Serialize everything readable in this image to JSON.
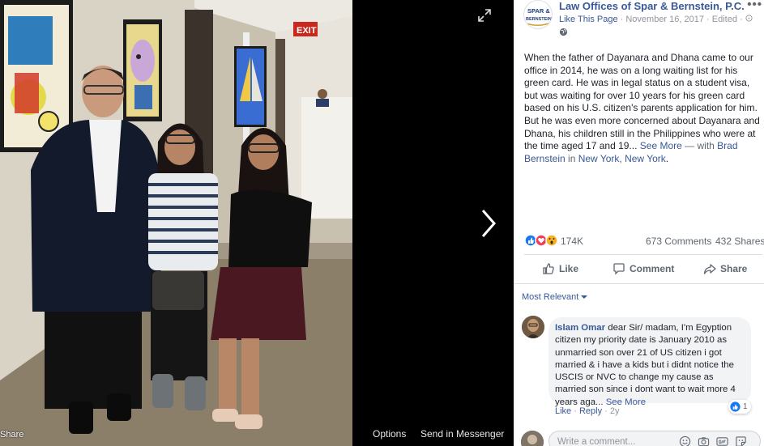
{
  "viewer": {
    "share_label": "Share",
    "options_label": "Options",
    "messenger_label": "Send in Messenger",
    "exit_sign_text": "EXIT"
  },
  "post": {
    "page_name": "Law Offices of Spar & Bernstein, P.C.",
    "logo_text_line1": "SPAR &",
    "logo_text_line2": "BERNSTEIN",
    "like_page": "Like This Page",
    "meta_rest": " · November 16, 2017 · Edited · ",
    "body": "When the father of Dayanara and Dhana came to our office in 2014, he was on a long waiting list for his green card. He was in legal status on a student visa, but was waiting for over 10 years for his green card based on his U.S. citizen's parents application for him. But he was even more concerned about Dayanara and Dhana, his children still in the Philippines who were at the time aged 17 and 19...",
    "see_more": "See More",
    "with_text": " — with ",
    "tagged_person": "Brad Bernstein",
    "in_text": " in ",
    "location": "New York, New York",
    "period": "."
  },
  "stats": {
    "reactions": "174K",
    "comments": "673 Comments",
    "shares": "432 Shares"
  },
  "actions": {
    "like": "Like",
    "comment": "Comment",
    "share": "Share"
  },
  "comments_section": {
    "sort_label": "Most Relevant",
    "comment": {
      "author": "Islam Omar",
      "text": "dear Sir/ madam, I'm Egyption citizen my priority date is January 2010 as unmarried son over 21 of US citizen i got married & i have a kids but i didnt notice the USCIS or NVC to change my cause as married son since i dont want to wait more 4 years aga...",
      "see_more": "See More",
      "like_count": "1",
      "like_action": "Like",
      "reply_action": "Reply",
      "age": "2y"
    },
    "write_placeholder": "Write a comment..."
  },
  "colors": {
    "link": "#385898",
    "secondary_text": "#606770",
    "meta_text": "#90949c",
    "like_blue": "#1877f2",
    "love_red": "#f33e58",
    "wow_yellow": "#f7b125"
  },
  "icons": [
    "expand-icon",
    "chevron-right-icon",
    "more-dots-icon",
    "globe-icon",
    "like-reaction-icon",
    "love-reaction-icon",
    "wow-reaction-icon",
    "thumbs-up-icon",
    "comment-bubble-icon",
    "share-arrow-icon",
    "caret-down-icon",
    "emoji-icon",
    "camera-icon",
    "gif-icon",
    "sticker-icon"
  ]
}
